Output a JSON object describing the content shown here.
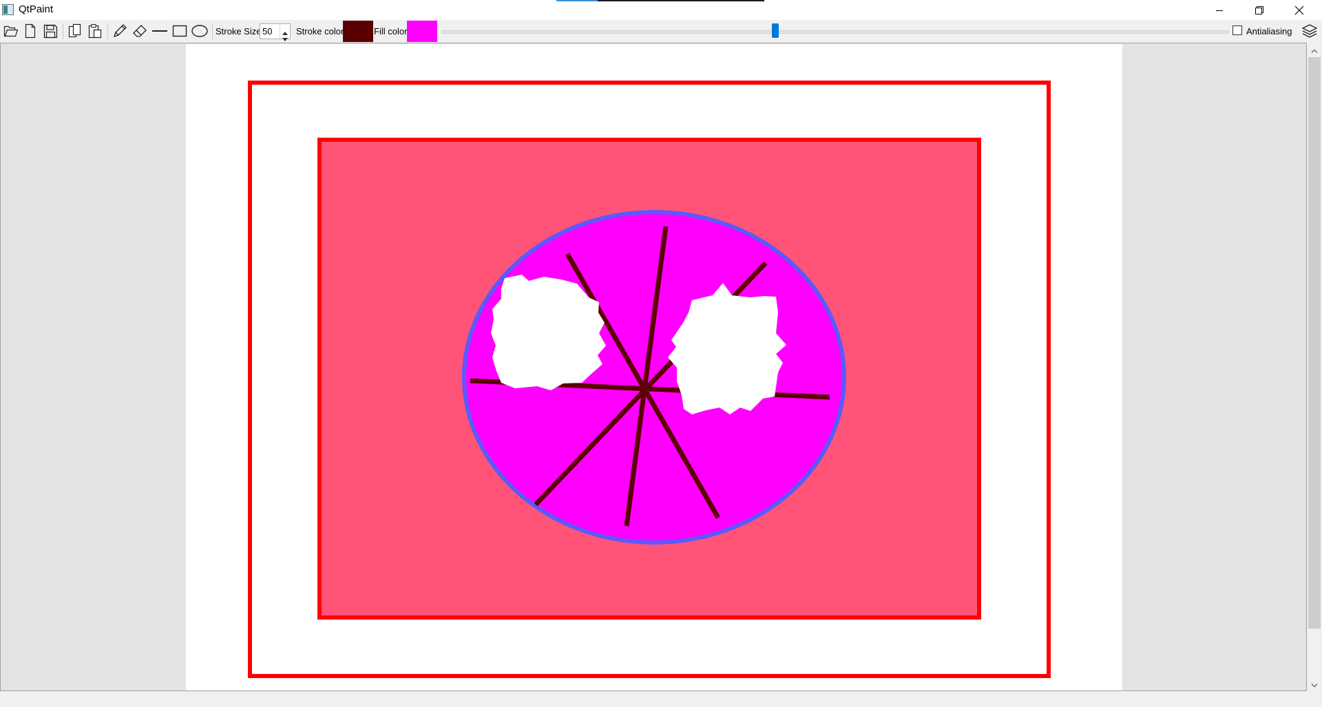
{
  "window": {
    "title": "QtPaint"
  },
  "toolbar": {
    "icons": [
      "open-folder-icon",
      "new-file-icon",
      "save-icon",
      "copy-icon",
      "paste-icon",
      "pencil-icon",
      "eraser-icon",
      "line-icon",
      "rectangle-icon",
      "ellipse-icon"
    ],
    "stroke_size_label": "Stroke Size",
    "stroke_size_value": "50",
    "stroke_color_label": "Stroke color",
    "stroke_color": "#5a0000",
    "fill_color_label": "Fill color",
    "fill_color": "#ff00ff",
    "antialiasing_label": "Antialiasing",
    "antialiasing_checked": false
  },
  "canvas": {
    "background": "#ffffff",
    "outer_rect_stroke": "#ff0000",
    "inner_rect_fill": "#ff5478",
    "inner_rect_stroke": "#ff0000",
    "ellipse_fill": "#ff00ff",
    "ellipse_stroke": "#5a5aff",
    "line_color": "#5a0000",
    "eraser_color": "#ffffff"
  }
}
